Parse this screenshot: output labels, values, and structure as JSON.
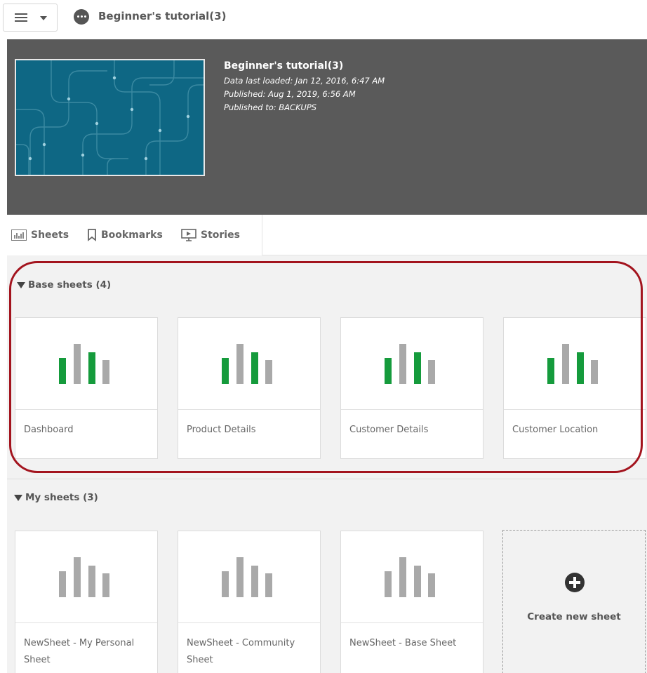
{
  "toolbar": {
    "menu_icon": "hamburger-icon",
    "app_icon": "more-circle-icon",
    "app_title": "Beginner's tutorial(3)"
  },
  "app_header": {
    "title": "Beginner's tutorial(3)",
    "data_last_loaded": "Data last loaded: Jan 12, 2016, 6:47 AM",
    "published": "Published: Aug 1, 2019, 6:56 AM",
    "published_to": "Published to: BACKUPS"
  },
  "tabs": [
    {
      "label": "Sheets",
      "icon": "sheets-icon"
    },
    {
      "label": "Bookmarks",
      "icon": "bookmark-icon"
    },
    {
      "label": "Stories",
      "icon": "stories-icon"
    }
  ],
  "base_sheets": {
    "heading": "Base sheets (4)",
    "highlight_color": "#a3141e",
    "items": [
      {
        "label": "Dashboard"
      },
      {
        "label": "Product Details"
      },
      {
        "label": "Customer Details"
      },
      {
        "label": "Customer Location"
      }
    ]
  },
  "my_sheets": {
    "heading": "My sheets (3)",
    "items": [
      {
        "label": "NewSheet - My Personal Sheet"
      },
      {
        "label": "NewSheet - Community Sheet"
      },
      {
        "label": "NewSheet - Base Sheet"
      }
    ],
    "create_label": "Create new sheet"
  },
  "colors": {
    "header_bg": "#5a5a5a",
    "thumb_bg": "#0e6784",
    "bar_green": "#159b3c",
    "bar_gray": "#a9a9a9",
    "content_bg": "#f2f2f2"
  }
}
